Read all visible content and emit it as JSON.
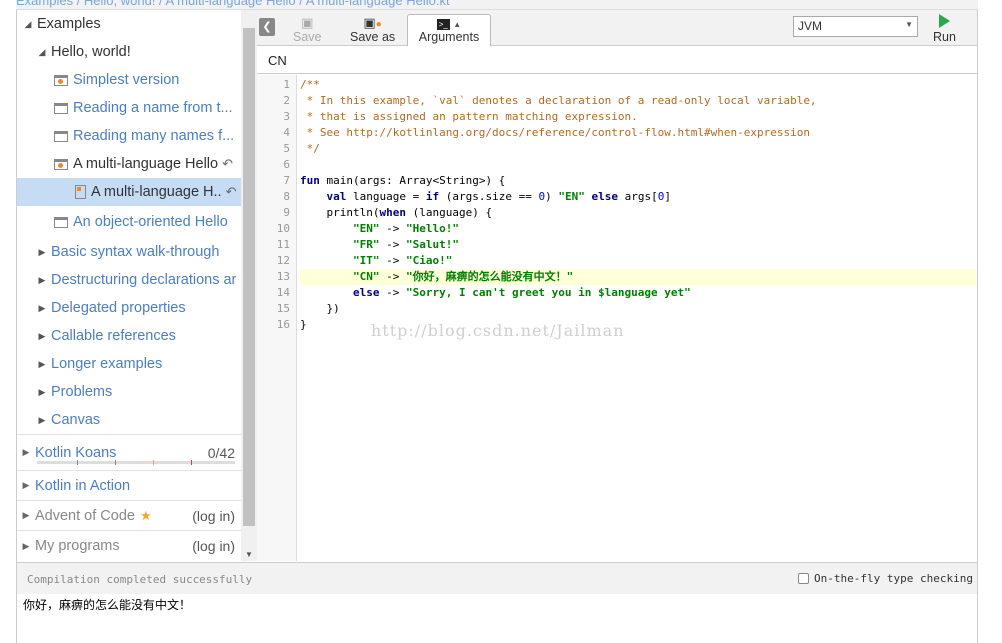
{
  "breadcrumb": "Examples / Hello, world! / A multi-language Hello / A multi-language Hello.kt",
  "sidebar": {
    "tree": [
      {
        "label": "Examples"
      },
      {
        "label": "Hello, world!"
      },
      {
        "label": "Simplest version"
      },
      {
        "label": "Reading a name from t..."
      },
      {
        "label": "Reading many names f..."
      },
      {
        "label": "A multi-language Hello"
      },
      {
        "label": "A multi-language H.."
      },
      {
        "label": "An object-oriented Hello"
      },
      {
        "label": "Basic syntax walk-through"
      },
      {
        "label": "Destructuring declarations ar"
      },
      {
        "label": "Delegated properties"
      },
      {
        "label": "Callable references"
      },
      {
        "label": "Longer examples"
      },
      {
        "label": "Problems"
      },
      {
        "label": "Canvas"
      }
    ],
    "sections": {
      "koans_label": "Kotlin Koans",
      "koans_progress": "0/42",
      "action_label": "Kotlin in Action",
      "advent_label": "Advent of Code",
      "advent_login": "(log in)",
      "programs_label": "My programs",
      "programs_login": "(log in)"
    }
  },
  "toolbar": {
    "save": "Save",
    "save_as": "Save as",
    "arguments": "Arguments",
    "target": "JVM",
    "run": "Run"
  },
  "args_value": "CN",
  "editor": {
    "line_numbers": [
      "1",
      "2",
      "3",
      "4",
      "5",
      "6",
      "7",
      "8",
      "9",
      "10",
      "11",
      "12",
      "13",
      "14",
      "15",
      "16"
    ],
    "watermark": "http://blog.csdn.net/Jailman"
  },
  "console": {
    "status": "Compilation completed successfully",
    "on_the_fly": "On-the-fly type checking",
    "output": "你好，麻痹的怎么能没有中文！"
  },
  "colors": {
    "accent": "#4a7fc0",
    "selected": "#c6dcf5",
    "run": "#2aa84a",
    "highlight_line": "#ffffd9"
  }
}
